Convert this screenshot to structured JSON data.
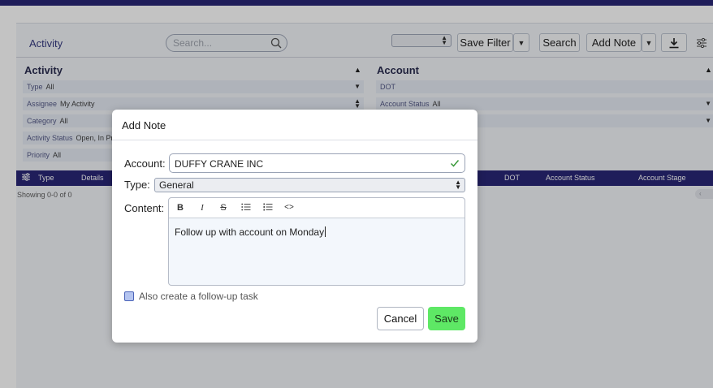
{
  "header": {
    "title": "Activity",
    "search_placeholder": "Search...",
    "save_filter_label": "Save Filter",
    "search_label": "Search",
    "add_note_label": "Add Note"
  },
  "filters": {
    "activity": {
      "title": "Activity",
      "rows": [
        {
          "label": "Type",
          "value": "All"
        },
        {
          "label": "Assignee",
          "value": "My Activity"
        },
        {
          "label": "Category",
          "value": "All"
        },
        {
          "label": "Activity Status",
          "value": "Open, In Pr"
        },
        {
          "label": "Priority",
          "value": "All"
        }
      ]
    },
    "account": {
      "title": "Account",
      "rows": [
        {
          "label": "DOT",
          "value": ""
        },
        {
          "label": "Account Status",
          "value": "All"
        }
      ]
    }
  },
  "table": {
    "columns": [
      "Type",
      "Details",
      "DOT",
      "Account Status",
      "Account Stage"
    ],
    "showing": "Showing 0-0 of 0"
  },
  "modal": {
    "title": "Add Note",
    "account_label": "Account:",
    "account_value": "DUFFY CRANE INC",
    "type_label": "Type:",
    "type_value": "General",
    "content_label": "Content:",
    "content_text": "Follow up with account on Monday",
    "toolbar": {
      "bold": "B",
      "italic": "I",
      "strike": "S",
      "code": "<>"
    },
    "followup_label": "Also create a follow-up task",
    "followup_checked": false,
    "cancel_label": "Cancel",
    "save_label": "Save"
  },
  "colors": {
    "nav": "#1d1a6e",
    "save_button": "#5ee865",
    "check": "#3a9a3a"
  }
}
